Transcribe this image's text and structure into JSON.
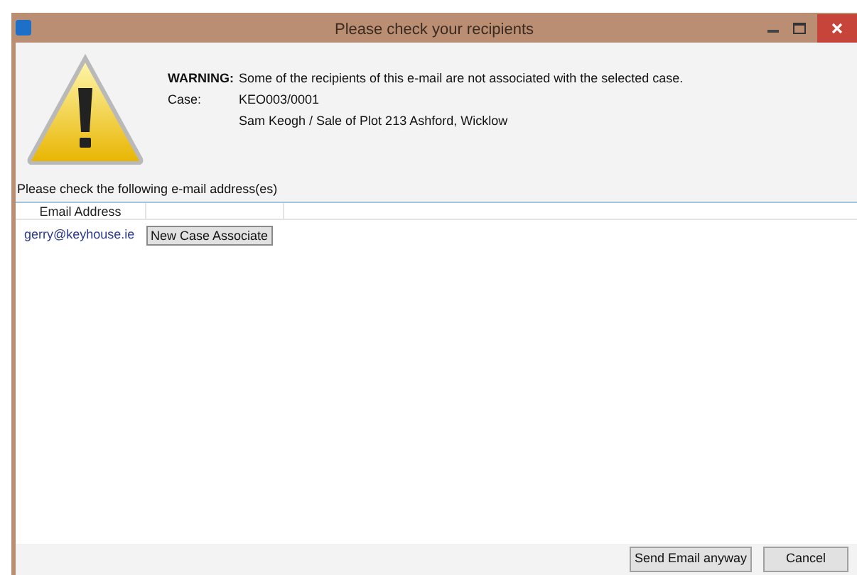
{
  "window": {
    "title": "Please check your recipients"
  },
  "warning": {
    "label": "WARNING:",
    "message": "Some of the recipients of this e-mail are not associated with the selected case."
  },
  "case": {
    "label": "Case:",
    "number": "KEO003/0001",
    "description": "Sam Keogh / Sale of Plot 213 Ashford, Wicklow"
  },
  "instruction": "Please check the following e-mail address(es)",
  "table": {
    "columns": [
      "Email Address"
    ],
    "rows": [
      {
        "email": "gerry@keyhouse.ie",
        "action": "New Case Associate"
      }
    ]
  },
  "buttons": [
    "Send Email anyway",
    "Cancel"
  ]
}
